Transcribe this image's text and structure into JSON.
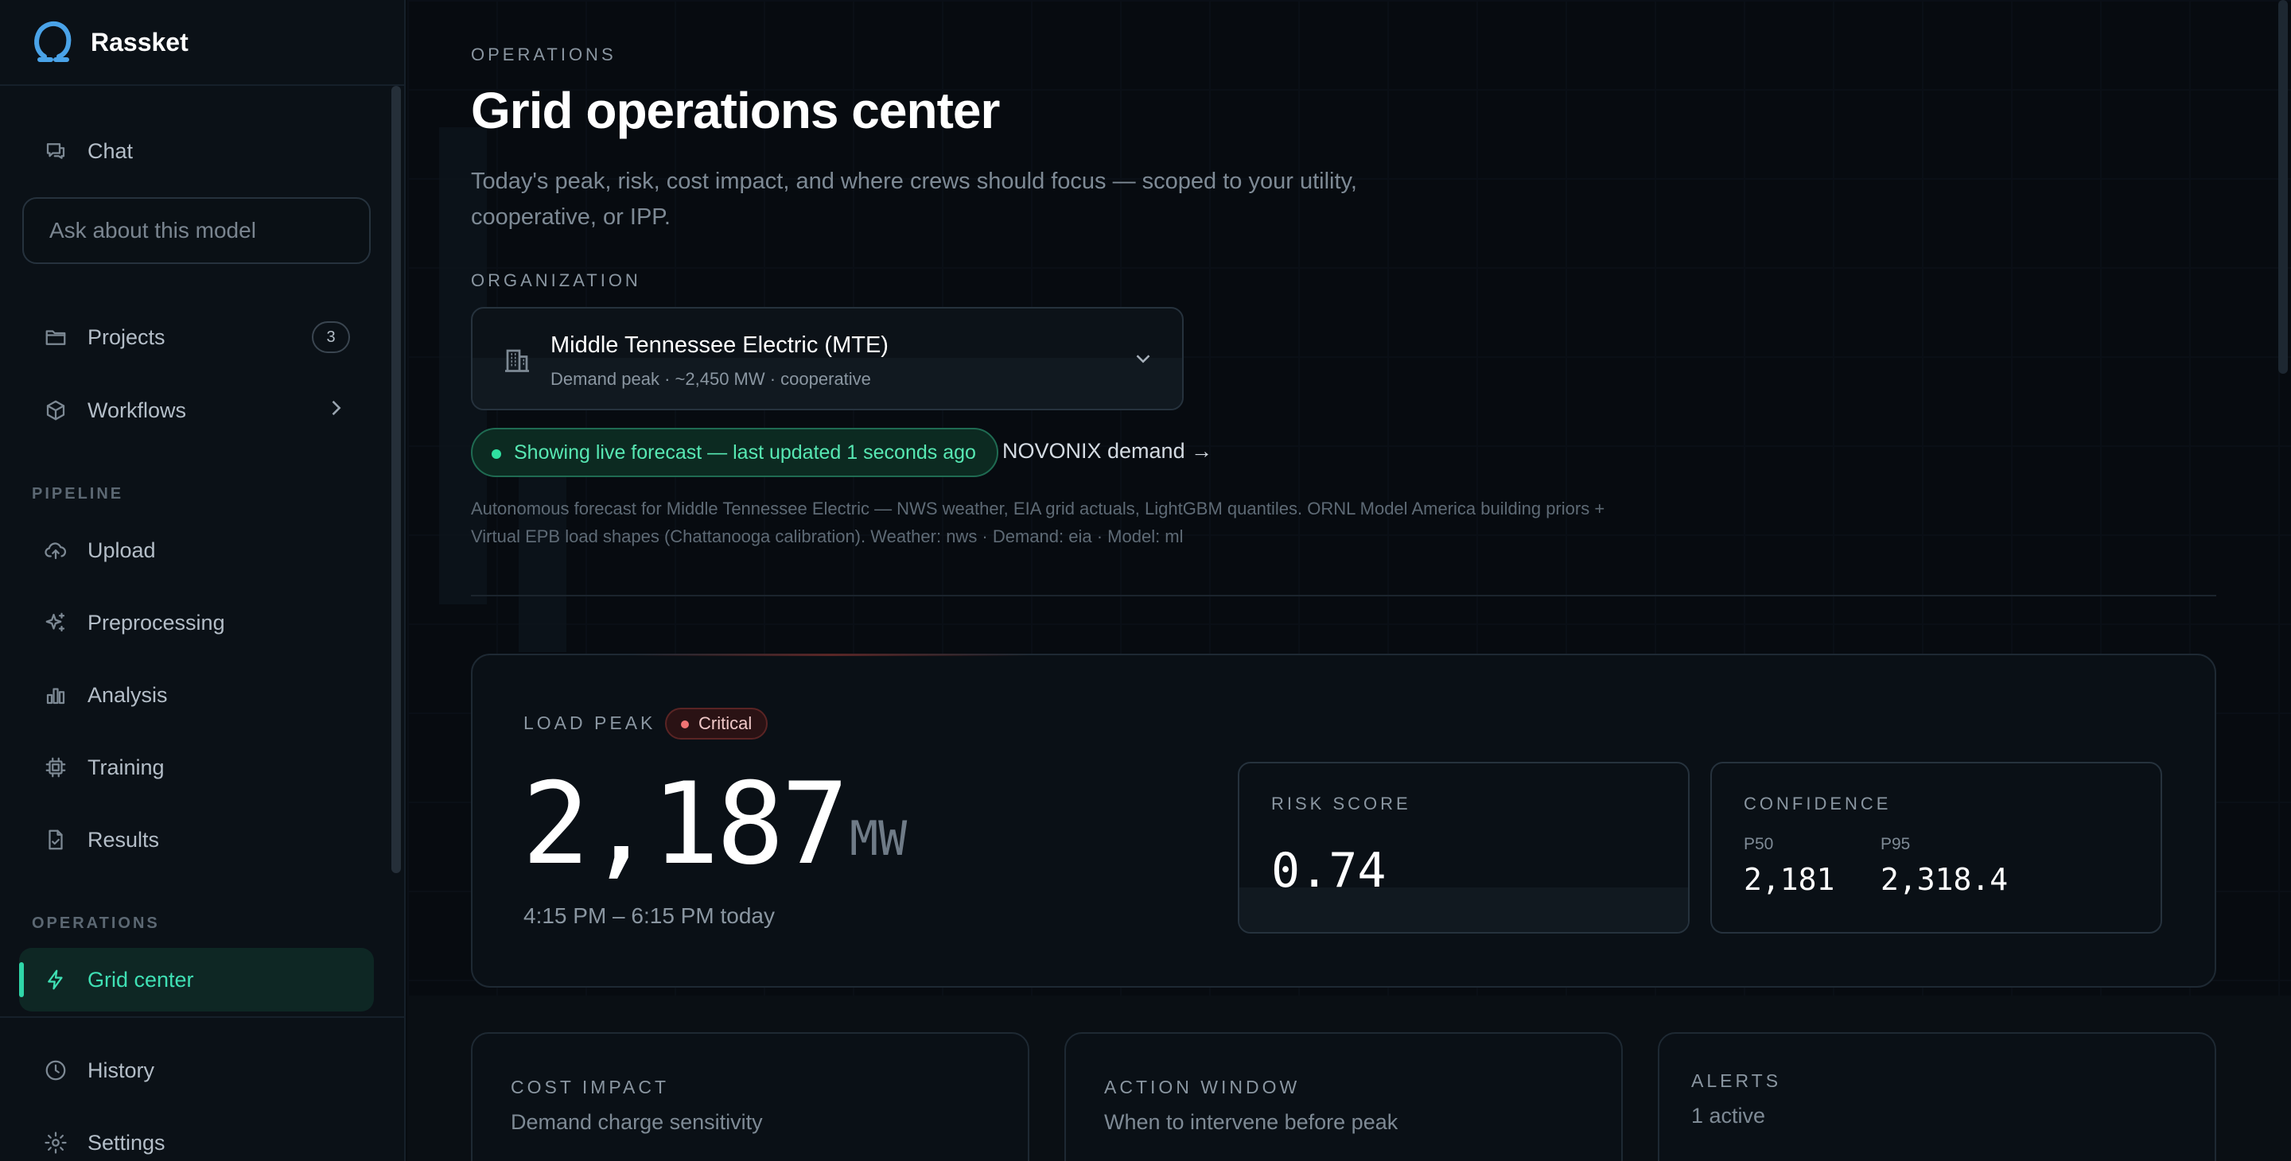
{
  "app": {
    "name": "Rassket"
  },
  "sidebar": {
    "chat_label": "Chat",
    "search_placeholder": "Ask about this model",
    "projects_label": "Projects",
    "projects_count": "3",
    "workflows_label": "Workflows",
    "pipeline_heading": "PIPELINE",
    "pipeline_items": [
      "Upload",
      "Preprocessing",
      "Analysis",
      "Training",
      "Results"
    ],
    "operations_heading": "OPERATIONS",
    "grid_center_label": "Grid center",
    "history_label": "History",
    "settings_label": "Settings"
  },
  "header": {
    "eyebrow": "OPERATIONS",
    "title": "Grid operations center",
    "subtitle": "Today's peak, risk, cost impact, and where crews should focus — scoped to your utility, cooperative, or IPP."
  },
  "organization": {
    "label": "ORGANIZATION",
    "selected_name": "Middle Tennessee Electric (MTE)",
    "selected_meta": "Demand peak · ~2,450 MW · cooperative"
  },
  "status": {
    "live_text": "Showing live forecast — last updated 1 seconds ago",
    "novonix_link": "NOVONIX demand →",
    "description": "Autonomous forecast for Middle Tennessee Electric — NWS weather, EIA grid actuals, LightGBM quantiles. ORNL Model America building priors + Virtual EPB load shapes (Chattanooga calibration). Weather: nws · Demand: eia · Model: ml"
  },
  "load_peak": {
    "label": "LOAD PEAK",
    "severity": "Critical",
    "value": "2,187",
    "unit": "MW",
    "window": "4:15 PM – 6:15 PM today"
  },
  "risk": {
    "label": "RISK SCORE",
    "value": "0.74"
  },
  "confidence": {
    "label": "CONFIDENCE",
    "p50_label": "P50",
    "p50_value": "2,181",
    "p95_label": "P95",
    "p95_value": "2,318.4"
  },
  "cards": {
    "cost_label": "COST IMPACT",
    "cost_sub": "Demand charge sensitivity",
    "action_label": "ACTION WINDOW",
    "action_sub": "When to intervene before peak",
    "alerts_label": "ALERTS",
    "alerts_sub": "1 active"
  },
  "colors": {
    "accent": "#2fd6a8",
    "live_green": "#57e8b3",
    "critical_red": "#f07474",
    "background": "#070b10"
  }
}
